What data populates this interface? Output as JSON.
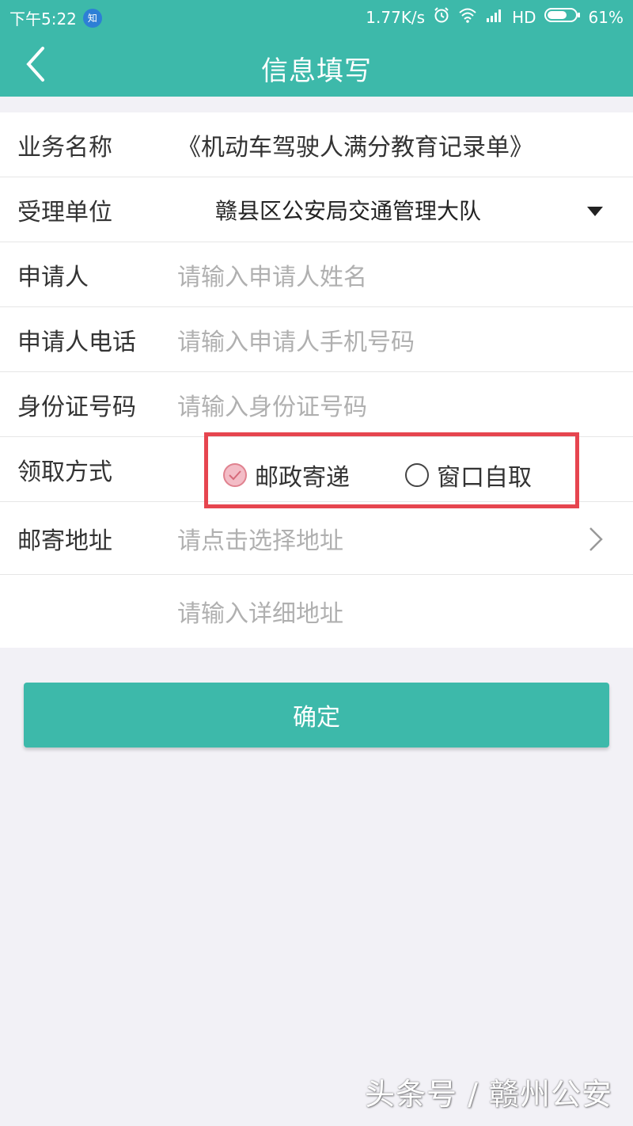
{
  "status_bar": {
    "time": "下午5:22",
    "badge": "知",
    "speed": "1.77K/s",
    "network": "HD",
    "battery": "61%"
  },
  "header": {
    "title": "信息填写",
    "back_icon": "chevron-left-icon"
  },
  "form": {
    "service_name": {
      "label": "业务名称",
      "value": "《机动车驾驶人满分教育记录单》"
    },
    "office": {
      "label": "受理单位",
      "value": "赣县区公安局交通管理大队"
    },
    "applicant": {
      "label": "申请人",
      "placeholder": "请输入申请人姓名"
    },
    "phone": {
      "label": "申请人电话",
      "placeholder": "请输入申请人手机号码"
    },
    "id_number": {
      "label": "身份证号码",
      "placeholder": "请输入身份证号码"
    },
    "pickup": {
      "label": "领取方式",
      "options": [
        "邮政寄递",
        "窗口自取"
      ],
      "selected": "邮政寄递"
    },
    "address": {
      "label": "邮寄地址",
      "placeholder": "请点击选择地址"
    },
    "detail_address": {
      "placeholder": "请输入详细地址"
    }
  },
  "confirm_button": {
    "label": "确定"
  },
  "watermark": "头条号 / 赣州公安",
  "colors": {
    "accent": "#3db9aa",
    "highlight": "#e6454f",
    "radio_checked": "#f3bcc6"
  }
}
